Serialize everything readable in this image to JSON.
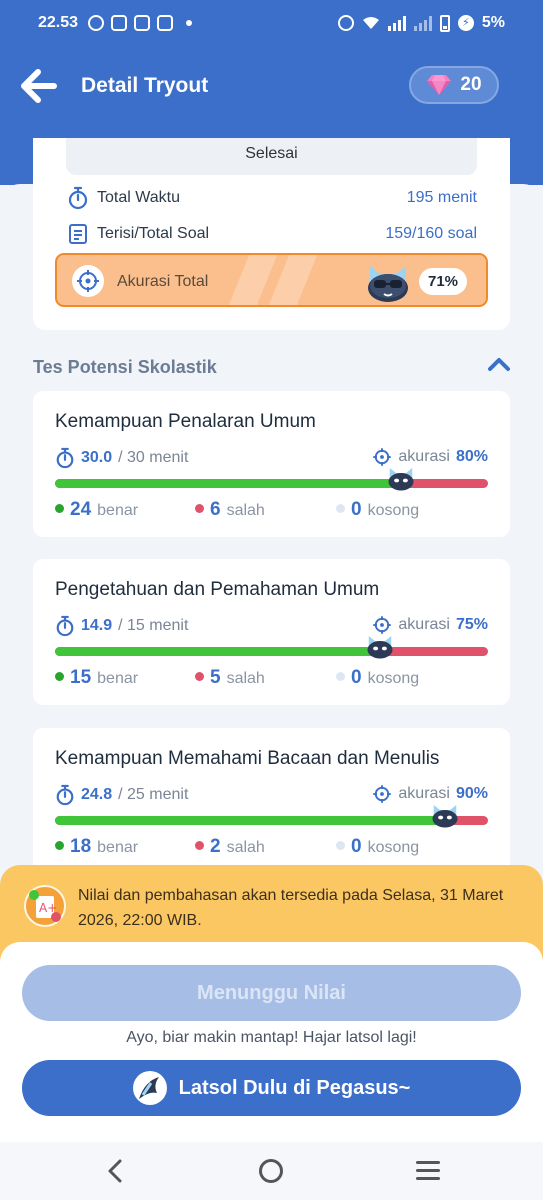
{
  "status_bar": {
    "time": "22.53",
    "battery": "5%"
  },
  "header": {
    "title": "Detail Tryout",
    "gems": "20"
  },
  "summary": {
    "status": "Selesai",
    "total_waktu_label": "Total Waktu",
    "total_waktu_value": "195 menit",
    "terisi_label": "Terisi/Total Soal",
    "terisi_value": "159/160 soal",
    "akurasi_label": "Akurasi Total",
    "akurasi_value": "71%"
  },
  "section": {
    "title": "Tes Potensi Skolastik"
  },
  "subtests": [
    {
      "title": "Kemampuan Penalaran Umum",
      "time_used": "30.0",
      "time_total": "/ 30 menit",
      "akurasi_label": "akurasi",
      "akurasi": "80%",
      "accuracy_fraction": 0.8,
      "benar": "24",
      "salah": "6",
      "kosong": "0",
      "benar_label": "benar",
      "salah_label": "salah",
      "kosong_label": "kosong"
    },
    {
      "title": "Pengetahuan dan Pemahaman Umum",
      "time_used": "14.9",
      "time_total": "/ 15 menit",
      "akurasi_label": "akurasi",
      "akurasi": "75%",
      "accuracy_fraction": 0.75,
      "benar": "15",
      "salah": "5",
      "kosong": "0",
      "benar_label": "benar",
      "salah_label": "salah",
      "kosong_label": "kosong"
    },
    {
      "title": "Kemampuan Memahami Bacaan dan Menulis",
      "time_used": "24.8",
      "time_total": "/ 25 menit",
      "akurasi_label": "akurasi",
      "akurasi": "90%",
      "accuracy_fraction": 0.9,
      "benar": "18",
      "salah": "2",
      "kosong": "0",
      "benar_label": "benar",
      "salah_label": "salah",
      "kosong_label": "kosong"
    }
  ],
  "notice": {
    "text": "Nilai dan pembahasan akan tersedia pada Selasa, 31 Maret 2026, 22:00 WIB."
  },
  "actions": {
    "wait_label": "Menunggu Nilai",
    "motivation": "Ayo, biar makin mantap! Hajar latsol lagi!",
    "latsol_label": "Latsol Dulu di Pegasus~"
  },
  "colors": {
    "primary": "#3b6fc9",
    "correct": "#3fc43a",
    "wrong": "#e0526a",
    "empty": "#dde6f3",
    "accuracy_box": "#fbbf8e",
    "notice": "#fbc763"
  }
}
